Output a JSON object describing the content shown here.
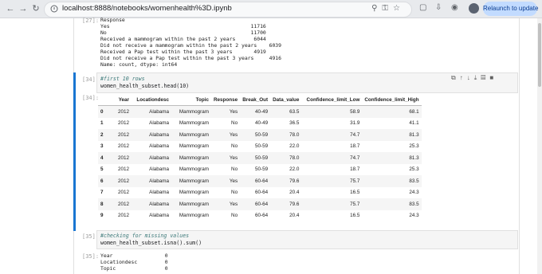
{
  "browser": {
    "url": "localhost:8888/notebooks/womenhealth%3D.ipynb",
    "relaunch_label": "Relaunch to update",
    "back_icon": "arrow-left-icon",
    "forward_icon": "arrow-right-icon",
    "reload_icon": "reload-icon"
  },
  "cells": {
    "out27": {
      "prompt": "[27]:",
      "lines": [
        "Response",
        "Yes                                              11716",
        "No                                               11700",
        "Received a mammogram within the past 2 years      6044",
        "Did not receive a mammogram within the past 2 years    6039",
        "Received a Pap test within the past 3 years       4919",
        "Did not receive a Pap test within the past 3 years     4916",
        "Name: count, dtype: int64"
      ]
    },
    "in34": {
      "prompt": "[34]:",
      "comment": "#first 10 rows",
      "code": "women_health_subset.head(10)"
    },
    "out34": {
      "prompt": "[34]:",
      "columns": [
        "",
        "Year",
        "Locationdesc",
        "Topic",
        "Response",
        "Break_Out",
        "Data_value",
        "Confidence_limit_Low",
        "Confidence_limit_High"
      ],
      "rows": [
        [
          "0",
          "2012",
          "Alabama",
          "Mammogram",
          "Yes",
          "40-49",
          "63.5",
          "58.9",
          "68.1"
        ],
        [
          "1",
          "2012",
          "Alabama",
          "Mammogram",
          "No",
          "40-49",
          "36.5",
          "31.9",
          "41.1"
        ],
        [
          "2",
          "2012",
          "Alabama",
          "Mammogram",
          "Yes",
          "50-59",
          "78.0",
          "74.7",
          "81.3"
        ],
        [
          "3",
          "2012",
          "Alabama",
          "Mammogram",
          "No",
          "50-59",
          "22.0",
          "18.7",
          "25.3"
        ],
        [
          "4",
          "2012",
          "Alabama",
          "Mammogram",
          "Yes",
          "50-59",
          "78.0",
          "74.7",
          "81.3"
        ],
        [
          "5",
          "2012",
          "Alabama",
          "Mammogram",
          "No",
          "50-59",
          "22.0",
          "18.7",
          "25.3"
        ],
        [
          "6",
          "2012",
          "Alabama",
          "Mammogram",
          "Yes",
          "60-64",
          "79.6",
          "75.7",
          "83.5"
        ],
        [
          "7",
          "2012",
          "Alabama",
          "Mammogram",
          "No",
          "60-64",
          "20.4",
          "16.5",
          "24.3"
        ],
        [
          "8",
          "2012",
          "Alabama",
          "Mammogram",
          "Yes",
          "60-64",
          "79.6",
          "75.7",
          "83.5"
        ],
        [
          "9",
          "2012",
          "Alabama",
          "Mammogram",
          "No",
          "60-64",
          "20.4",
          "16.5",
          "24.3"
        ]
      ]
    },
    "in35": {
      "prompt": "[35]:",
      "comment": "#checking for missing values",
      "code": "women_health_subset.isna().sum()"
    },
    "out35": {
      "prompt": "[35]:",
      "lines": [
        "Year                 0",
        "Locationdesc         0",
        "Topic                0"
      ]
    }
  }
}
